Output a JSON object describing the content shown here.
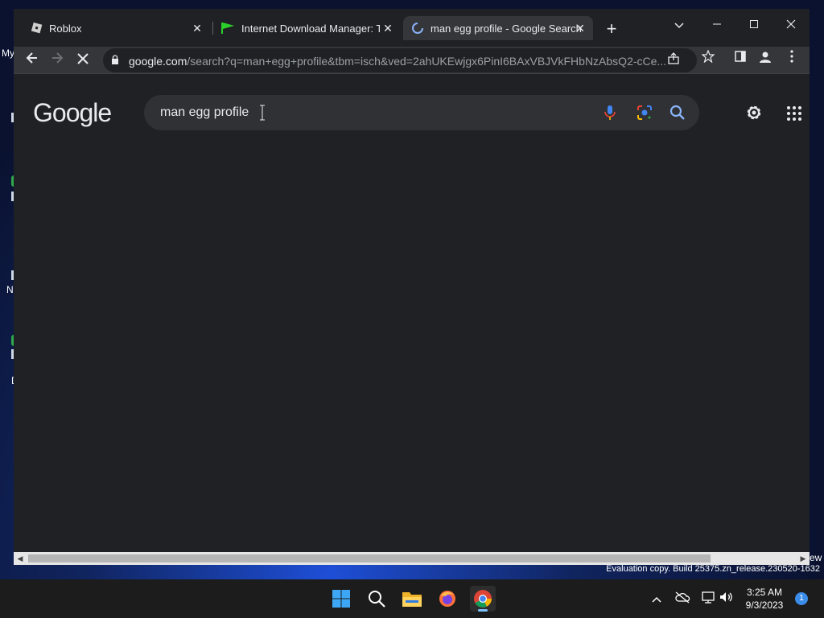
{
  "desktop": {
    "fragments": [
      "My",
      "N",
      "D"
    ],
    "edge_text": "ew",
    "watermark": "Evaluation copy. Build 25375.zn_release.230520-1632"
  },
  "browser": {
    "tabs": [
      {
        "title": "Roblox",
        "active": false
      },
      {
        "title": "Internet Download Manager: The",
        "active": false
      },
      {
        "title": "man egg profile - Google Search",
        "active": true
      }
    ],
    "address": {
      "host": "google.com",
      "path": "/search?q=man+egg+profile&tbm=isch&ved=2ahUKEwjgx6PinI6BAxVBJVkFHbNzAbsQ2-cCe..."
    }
  },
  "page": {
    "logo": "Google",
    "query": "man egg profile"
  },
  "taskbar": {
    "time": "3:25 AM",
    "date": "9/3/2023",
    "notification_count": "1"
  },
  "colors": {
    "page_bg": "#202124",
    "toolbar_bg": "#35363a",
    "accent_blue": "#8ab4f8"
  }
}
